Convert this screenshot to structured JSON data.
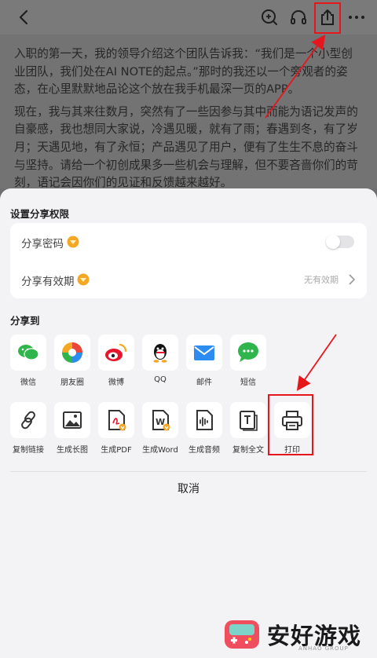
{
  "article": {
    "p1": "入职的第一天，我的领导介绍这个团队告诉我：“我们是一个小型创业团队，我们处在AI NOTE的起点。”那时的我还以一个旁观者的姿态，在心里默默地品论这个放在我手机最深一页的APP。",
    "p2": "现在，我与其来往数月，突然有了一些因参与其中而能为语记发声的自豪感，我也想同大家说，冷遇见暖，就有了雨；春遇到冬，有了岁月；天遇见地，有了永恒；产品遇见了用户，便有了生生不息的奋斗与坚持。请给一个初创成果多一些机会与理解，但不要吝啬你们的苛刻，语记会因你们的见证和反馈越来越好。"
  },
  "permissions": {
    "title": "设置分享权限",
    "password_label": "分享密码",
    "validity_label": "分享有效期",
    "validity_value": "无有效期"
  },
  "share": {
    "title": "分享到",
    "row1": [
      "微信",
      "朋友圈",
      "微博",
      "QQ",
      "邮件",
      "短信"
    ],
    "row2": [
      "复制链接",
      "生成长图",
      "生成PDF",
      "生成Word",
      "生成音频",
      "复制全文",
      "打印"
    ]
  },
  "cancel_label": "取消",
  "watermark": {
    "name": "安好游戏",
    "sub": "ANHAO GROUP"
  },
  "colors": {
    "accent_red": "#e6161d",
    "wechat_green": "#2fb54b",
    "mail_blue": "#2d8cf0",
    "badge_gold": "#f5a623"
  }
}
